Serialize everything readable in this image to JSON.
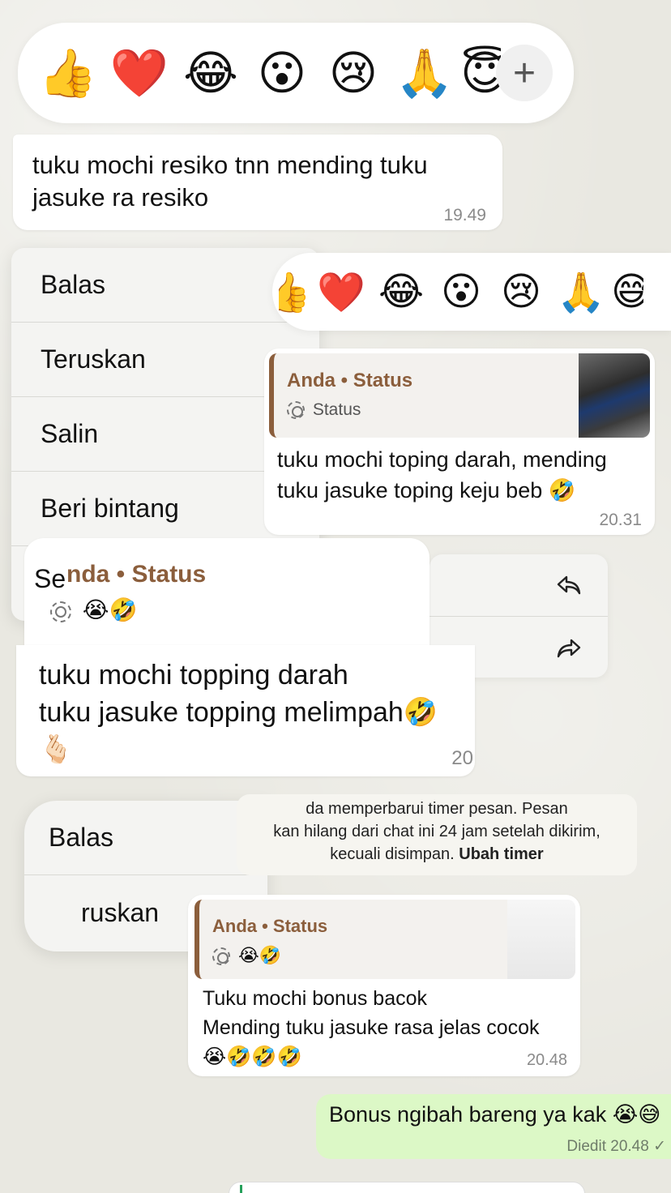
{
  "reactions_top": [
    "👍",
    "❤️",
    "😂",
    "😮",
    "😢",
    "🙏",
    "😇"
  ],
  "reactions_mid": [
    "👍",
    "❤️",
    "😂",
    "😮",
    "😢",
    "🙏",
    "😅"
  ],
  "plus_label": "+",
  "msg1": {
    "text_line1": "tuku mochi resiko tnn mending tuku",
    "text_line2": "jasuke ra resiko",
    "time": "19.49"
  },
  "menu1": {
    "items": [
      "Balas",
      "Teruskan",
      "Salin",
      "Beri bintang",
      "Se"
    ]
  },
  "msg2": {
    "quote_title": "Anda • Status",
    "quote_sub": "Status",
    "text_line1": "tuku mochi toping darah, mending",
    "text_line2": "tuku jasuke toping keju beb 🤣",
    "time": "20.31"
  },
  "msg3": {
    "quote_title": "nda • Status",
    "quote_emojis": "😭🤣",
    "text_line1": "tuku mochi topping darah",
    "text_line2": "tuku jasuke topping melimpah🤣",
    "text_line3": "🫰🏻",
    "time": "20"
  },
  "side_icons": [
    "reply-arrow",
    "forward-arrow"
  ],
  "menu2": {
    "items": [
      "Balas",
      "ruskan"
    ]
  },
  "system_notice": {
    "line1": "da memperbarui timer pesan. Pesan",
    "line2": "kan hilang dari chat ini 24 jam setelah dikirim,",
    "line3_prefix": "kecuali disimpan.",
    "line3_link": "Ubah timer"
  },
  "msg4": {
    "quote_title": "Anda • Status",
    "quote_emojis": "😭🤣",
    "text_line1": "Tuku mochi bonus bacok",
    "text_line2": "Mending tuku jasuke rasa jelas cocok",
    "text_line3": "😭🤣🤣🤣",
    "time": "20.48"
  },
  "msg_out": {
    "text": "Bonus ngibah bareng ya kak 😭😅",
    "edited": "Diedit",
    "time": "20.48",
    "tick": "✓"
  },
  "colors": {
    "accent_quote": "#8b5e3c",
    "outgoing": "#dcf8c6",
    "bg": "#e9e8e1"
  }
}
